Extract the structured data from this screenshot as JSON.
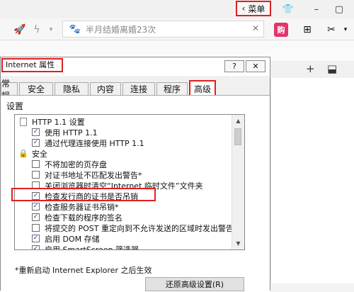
{
  "browser": {
    "menu_label": "菜单",
    "address_text": "半月结婚离婚23次",
    "gou_label": "购"
  },
  "dialog": {
    "title": "Internet 属性",
    "help_label": "?",
    "close_label": "✕",
    "tabs": [
      "常规",
      "安全",
      "隐私",
      "内容",
      "连接",
      "程序",
      "高级"
    ],
    "active_tab": "高级",
    "settings_label": "设置",
    "items": [
      {
        "type": "group",
        "icon": "document-icon",
        "label": "HTTP 1.1 设置"
      },
      {
        "type": "check",
        "checked": true,
        "label": "使用 HTTP 1.1"
      },
      {
        "type": "check",
        "checked": true,
        "label": "通过代理连接使用 HTTP 1.1"
      },
      {
        "type": "group",
        "icon": "lock-icon",
        "label": "安全"
      },
      {
        "type": "check",
        "checked": false,
        "label": "不将加密的页存盘"
      },
      {
        "type": "check",
        "checked": false,
        "label": "对证书地址不匹配发出警告*"
      },
      {
        "type": "check",
        "checked": false,
        "label": "关闭浏览器时清空“Internet 临时文件”文件夹"
      },
      {
        "type": "check",
        "checked": true,
        "label": "检查发行商的证书是否吊销"
      },
      {
        "type": "check",
        "checked": true,
        "label": "检查服务器证书吊销*"
      },
      {
        "type": "check",
        "checked": true,
        "label": "检查下载的程序的签名"
      },
      {
        "type": "check",
        "checked": false,
        "label": "将提交的 POST 重定向到不允许发送的区域时发出警告"
      },
      {
        "type": "check",
        "checked": true,
        "label": "启用 DOM 存储"
      },
      {
        "type": "check",
        "checked": true,
        "label": "启用 SmartScreen 筛选器"
      }
    ],
    "note": "*重新启动 Internet Explorer 之后生效",
    "restore_button": "还原高级设置(R)"
  }
}
